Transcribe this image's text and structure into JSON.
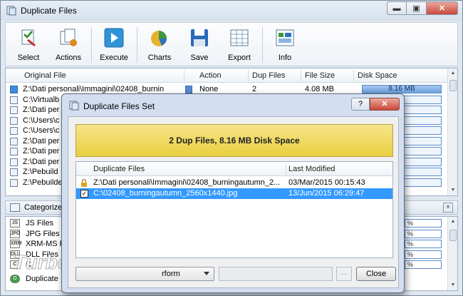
{
  "window": {
    "title": "Duplicate Files"
  },
  "toolbar": {
    "select": "Select",
    "actions": "Actions",
    "execute": "Execute",
    "charts": "Charts",
    "save": "Save",
    "export": "Export",
    "info": "Info"
  },
  "list": {
    "columns": [
      "Original File",
      "Action",
      "Dup Files",
      "File Size",
      "Disk Space"
    ],
    "first_row": {
      "file": "Z:\\Dati personali\\Immagini\\02408_burnin",
      "action": "None",
      "dup_files": "2",
      "file_size": "4.08 MB",
      "disk_space": "8.16 MB"
    },
    "rows": [
      "C:\\Virtualb",
      "Z:\\Dati per",
      "C:\\Users\\c",
      "C:\\Users\\c",
      "Z:\\Dati per",
      "Z:\\Dati per",
      "Z:\\Dati per",
      "Z:\\Pebuild",
      "Z:\\Pebuilde"
    ]
  },
  "categorize": {
    "label": "Categorize B",
    "close": "×",
    "rows": [
      {
        "icon": "JS",
        "label": "JS Files"
      },
      {
        "icon": "JPG",
        "label": "JPG Files"
      },
      {
        "icon": "XRM",
        "label": "XRM-MS F"
      },
      {
        "icon": "DLL",
        "label": "DLL Files"
      },
      {
        "icon": "C",
        "label": "C"
      },
      {
        "icon": "D",
        "label": "Duplicate"
      }
    ],
    "percent_symbol": "%"
  },
  "dialog": {
    "title": "Duplicate Files Set",
    "help": "?",
    "close": "✕",
    "banner": "2 Dup Files, 8.16 MB Disk Space",
    "columns": [
      "Duplicate Files",
      "Last Modified"
    ],
    "rows": [
      {
        "file": "Z:\\Dati personali\\Immagini\\02408_burningautumn_2...",
        "modified": "03/Mar/2015 00:15:43",
        "locked": true,
        "selected": false
      },
      {
        "file": "C:\\02408_burningautumn_2560x1440.jpg",
        "modified": "13/Jun/2015 06:29:47",
        "locked": false,
        "selected": true
      }
    ],
    "perform": "rform",
    "dots": "...",
    "close_button": "Close"
  },
  "watermark": {
    "text": "TurboLab.it"
  }
}
